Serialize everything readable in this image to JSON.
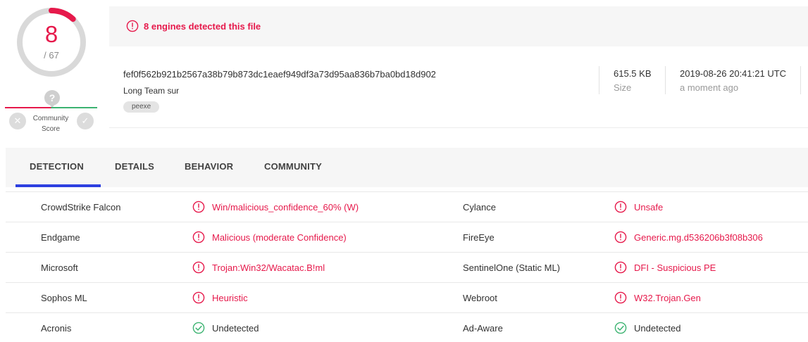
{
  "score": {
    "detected": "8",
    "total": "/ 67",
    "detected_value": 8,
    "total_value": 67
  },
  "community": {
    "question": "?",
    "label_line1": "Community",
    "label_line2": "Score",
    "down": "✕",
    "up": "✓"
  },
  "alert": {
    "text": "8 engines detected this file"
  },
  "file": {
    "hash": "fef0f562b921b2567a38b79b873dc1eaef949df3a73d95aa836b7ba0bd18d902",
    "name": "Long Team sur",
    "tag": "peexe",
    "size_value": "615.5 KB",
    "size_label": "Size",
    "date_value": "2019-08-26 20:41:21 UTC",
    "date_label": "a moment ago"
  },
  "tabs": [
    "DETECTION",
    "DETAILS",
    "BEHAVIOR",
    "COMMUNITY"
  ],
  "detections": [
    {
      "left": {
        "engine": "CrowdStrike Falcon",
        "result": "Win/malicious_confidence_60% (W)",
        "status": "malicious"
      },
      "right": {
        "engine": "Cylance",
        "result": "Unsafe",
        "status": "malicious"
      }
    },
    {
      "left": {
        "engine": "Endgame",
        "result": "Malicious (moderate Confidence)",
        "status": "malicious"
      },
      "right": {
        "engine": "FireEye",
        "result": "Generic.mg.d536206b3f08b306",
        "status": "malicious"
      }
    },
    {
      "left": {
        "engine": "Microsoft",
        "result": "Trojan:Win32/Wacatac.B!ml",
        "status": "malicious"
      },
      "right": {
        "engine": "SentinelOne (Static ML)",
        "result": "DFI - Suspicious PE",
        "status": "malicious"
      }
    },
    {
      "left": {
        "engine": "Sophos ML",
        "result": "Heuristic",
        "status": "malicious"
      },
      "right": {
        "engine": "Webroot",
        "result": "W32.Trojan.Gen",
        "status": "malicious"
      }
    },
    {
      "left": {
        "engine": "Acronis",
        "result": "Undetected",
        "status": "undetected"
      },
      "right": {
        "engine": "Ad-Aware",
        "result": "Undetected",
        "status": "undetected"
      }
    }
  ],
  "colors": {
    "malicious": "#e6194b",
    "clean": "#3cb371",
    "accent": "#2d3fe0"
  }
}
